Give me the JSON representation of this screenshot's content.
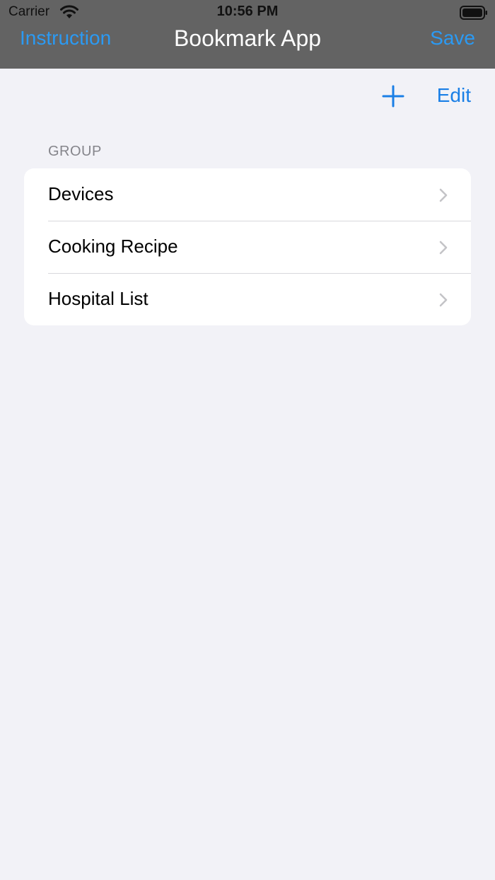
{
  "status_bar": {
    "carrier": "Carrier",
    "time": "10:56 PM",
    "wifi_icon": "wifi-icon",
    "battery_icon": "battery-icon"
  },
  "nav_bar": {
    "left_label": "Instruction",
    "title": "Bookmark App",
    "right_label": "Save",
    "background": "#636363",
    "accent": "#2b9af3"
  },
  "toolbar": {
    "add_icon": "plus-icon",
    "edit_label": "Edit",
    "tint": "#1a7fe6"
  },
  "group_section": {
    "header": "GROUP",
    "items": [
      {
        "label": "Devices",
        "accessory": "chevron-right-icon"
      },
      {
        "label": "Cooking Recipe",
        "accessory": "chevron-right-icon"
      },
      {
        "label": "Hospital List",
        "accessory": "chevron-right-icon"
      }
    ]
  }
}
